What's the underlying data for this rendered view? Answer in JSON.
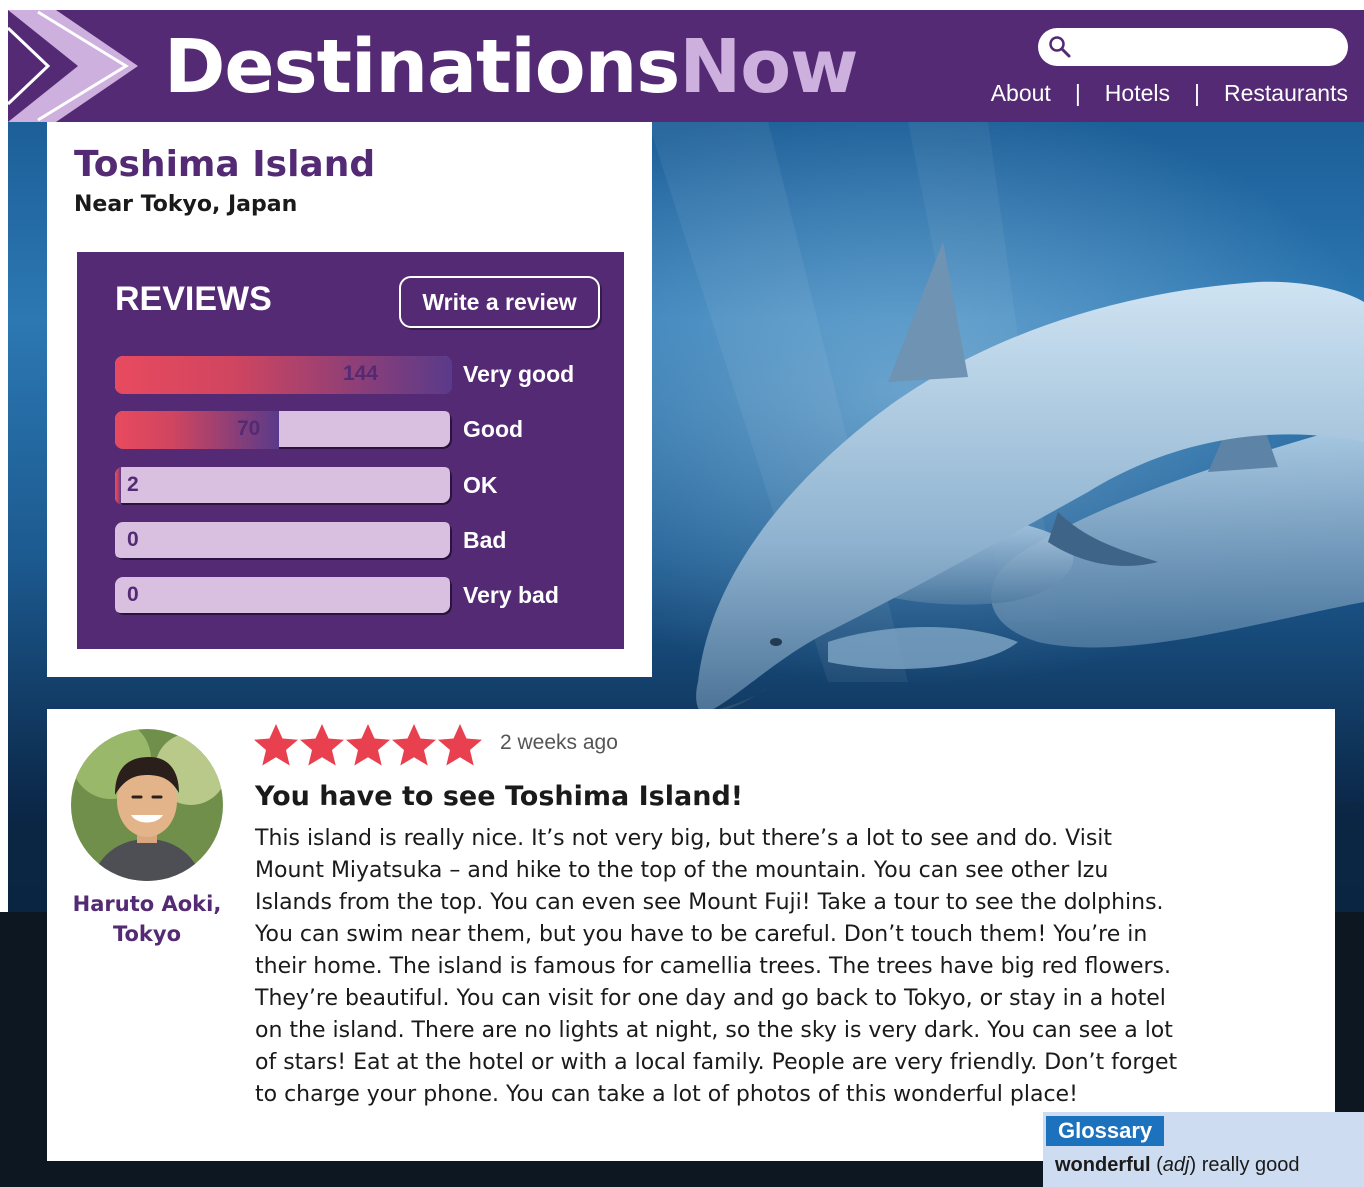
{
  "header": {
    "logo_primary": "Destinations",
    "logo_secondary": "Now",
    "search_placeholder": "",
    "nav": [
      {
        "label": "About"
      },
      {
        "label": "Hotels"
      },
      {
        "label": "Restaurants"
      }
    ],
    "nav_separator": "|"
  },
  "place": {
    "title": "Toshima Island",
    "subtitle": "Near Tokyo, Japan"
  },
  "reviews": {
    "heading": "REVIEWS",
    "write_label": "Write a review",
    "max_count": 144,
    "ratings": [
      {
        "label": "Very good",
        "count": "144",
        "fraction": 1.0
      },
      {
        "label": "Good",
        "count": "70",
        "fraction": 0.486
      },
      {
        "label": "OK",
        "count": "2",
        "fraction": 0.014
      },
      {
        "label": "Bad",
        "count": "0",
        "fraction": 0
      },
      {
        "label": "Very bad",
        "count": "0",
        "fraction": 0
      }
    ]
  },
  "review": {
    "stars": 5,
    "time": "2 weeks ago",
    "title": "You have to see Toshima Island!",
    "body": "This island is really nice. It’s not very big, but there’s a lot to see and do. Visit Mount Miyatsuka – and hike to the top of the mountain. You can see other Izu Islands from the top. You can even see Mount Fuji! Take a tour to see the dolphins. You can swim near them, but you have to be careful. Don’t touch them! You’re in their home. The island is famous for camellia trees. The trees have big red flowers. They’re beautiful. You can visit for one day and go back to Tokyo, or stay in a hotel on the island. There are no lights at night, so the sky is very dark. You can see a lot of stars! Eat at the hotel or with a local family. People are very friendly. Don’t forget to charge your phone. You can take a lot of photos of this wonderful place!",
    "reviewer_name": "Haruto Aoki,",
    "reviewer_city": "Tokyo"
  },
  "glossary": {
    "heading": "Glossary",
    "word": "wonderful",
    "pos": "adj",
    "definition": "really good"
  },
  "colors": {
    "brand_purple": "#532a73",
    "logo_accent": "#cdb0de",
    "bar_red": "#e84a5f",
    "star_red": "#e8404f",
    "glossary_blue": "#1d72bd"
  }
}
